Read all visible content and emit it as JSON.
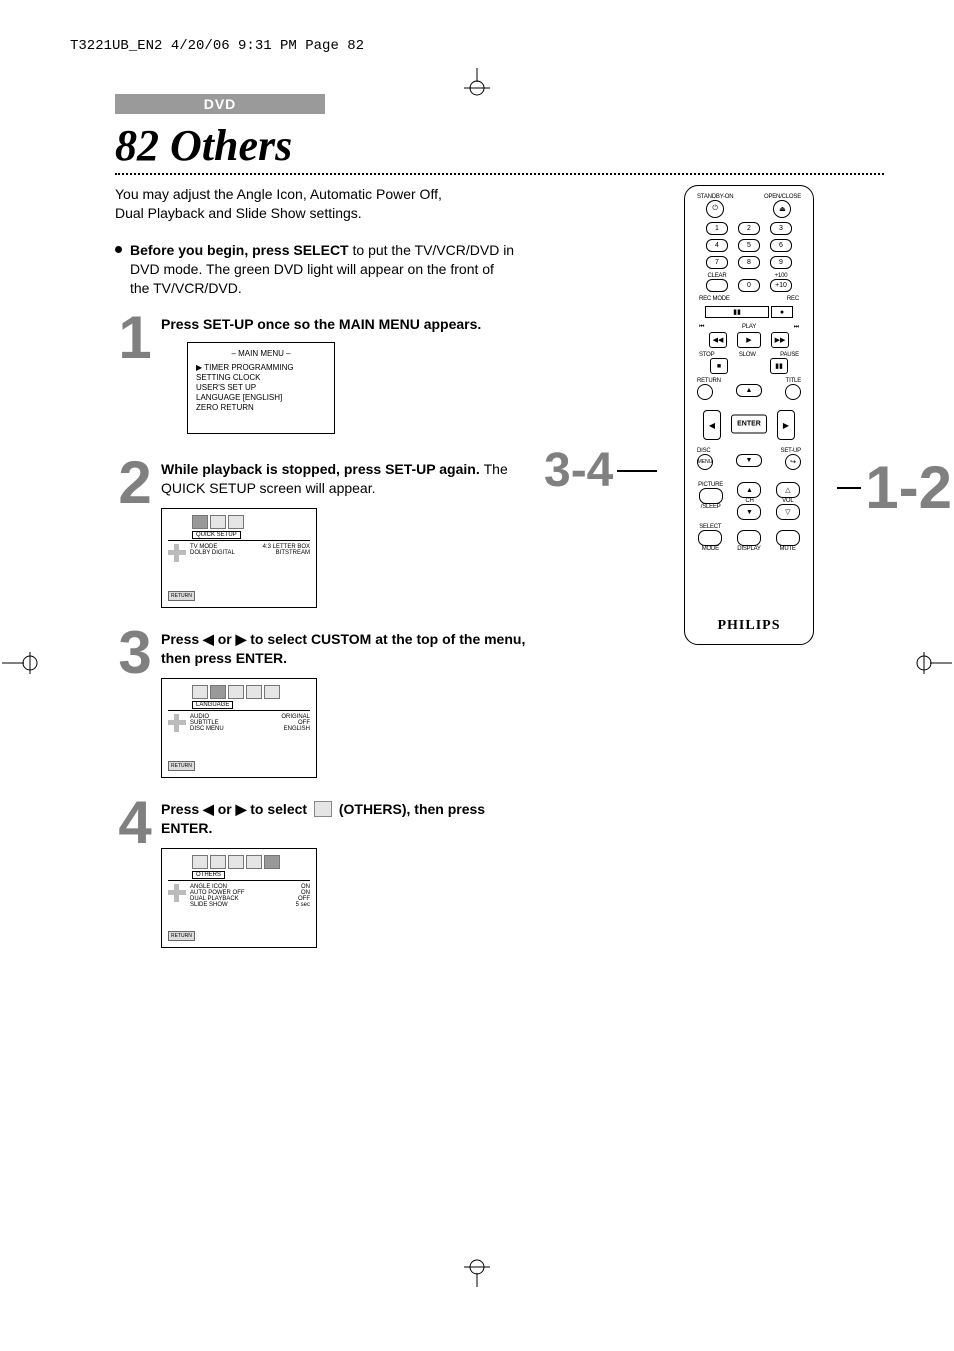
{
  "header_line": "T3221UB_EN2  4/20/06  9:31 PM  Page 82",
  "category": "DVD",
  "title": "82  Others",
  "intro": "You may adjust the Angle Icon, Automatic Power Off, Dual Playback and Slide Show settings.",
  "bullet_bold": "Before you begin, press SELECT",
  "bullet_rest": " to put the TV/VCR/DVD in DVD mode.  The green DVD light will appear on the front of the TV/VCR/DVD.",
  "steps": {
    "1": {
      "num": "1",
      "text_bold": "Press SET-UP once so the MAIN MENU appears."
    },
    "2": {
      "num": "2",
      "text_bold": "While playback is stopped, press SET-UP again.",
      "text_rest": " The QUICK SETUP screen will appear."
    },
    "3": {
      "num": "3",
      "text_pre": "Press ",
      "arrows": "◀ or ▶",
      "text_mid": " to select CUSTOM at the top of the menu, then press ENTER."
    },
    "4": {
      "num": "4",
      "text_pre": "Press ",
      "arrows": "◀ or ▶",
      "text_mid": "  to select  ",
      "parenlabel": "(OTHERS)",
      "text_post": ", then press ENTER."
    }
  },
  "main_menu": {
    "title": "– MAIN MENU –",
    "items": [
      "▶ TIMER PROGRAMMING",
      "   SETTING CLOCK",
      "   USER'S SET UP",
      "   LANGUAGE  [ENGLISH]",
      "   ZERO RETURN"
    ]
  },
  "quick_setup": {
    "label": "QUICK SETUP",
    "rows": [
      {
        "l": "TV MODE",
        "r": "4:3 LETTER BOX"
      },
      {
        "l": "DOLBY DIGITAL",
        "r": "BITSTREAM"
      }
    ],
    "return": "RETURN"
  },
  "language_screen": {
    "label": "LANGUAGE",
    "rows": [
      {
        "l": "AUDIO",
        "r": "ORIGINAL"
      },
      {
        "l": "SUBTITLE",
        "r": "OFF"
      },
      {
        "l": "DISC MENU",
        "r": "ENGLISH"
      }
    ],
    "return": "RETURN"
  },
  "others_screen": {
    "label": "OTHERS",
    "rows": [
      {
        "l": "ANGLE ICON",
        "r": "ON"
      },
      {
        "l": "AUTO POWER OFF",
        "r": "ON"
      },
      {
        "l": "DUAL PLAYBACK",
        "r": "OFF"
      },
      {
        "l": "SLIDE SHOW",
        "r": "5 sec"
      }
    ],
    "return": "RETURN"
  },
  "callouts": {
    "left": "3-4",
    "right": "1-2"
  },
  "remote": {
    "top": {
      "standby": "STANDBY-ON",
      "openclose": "OPEN/CLOSE"
    },
    "numpad": [
      "1",
      "2",
      "3",
      "4",
      "5",
      "6",
      "7",
      "8",
      "9",
      "0"
    ],
    "clear": "CLEAR",
    "plus100": "+100",
    "plus10": "+10",
    "recmode": "REC MODE",
    "rec": "REC",
    "play": "PLAY",
    "stop": "STOP",
    "slow": "SLOW",
    "pause": "PAUSE",
    "return": "RETURN",
    "title": "TITLE",
    "enter": "ENTER",
    "disc": "DISC",
    "setup": "SET-UP",
    "menu": "MENU",
    "picture": "PICTURE",
    "sleep": "/SLEEP",
    "ch": "CH",
    "vol": "VOL",
    "select": "SELECT",
    "mode": "MODE",
    "display": "DISPLAY",
    "mute": "MUTE",
    "brand": "PHILIPS"
  }
}
